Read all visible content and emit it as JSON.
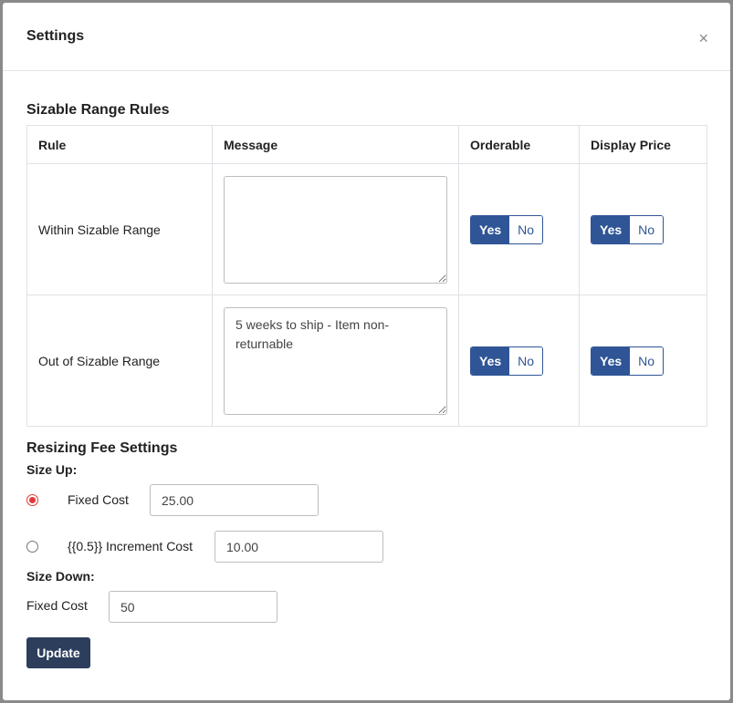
{
  "modal": {
    "title": "Settings",
    "close_label": "×"
  },
  "sizable_range": {
    "title": "Sizable Range Rules",
    "columns": [
      "Rule",
      "Message",
      "Orderable",
      "Display Price"
    ],
    "rows": [
      {
        "rule": "Within Sizable Range",
        "message": "",
        "orderable": {
          "yes": "Yes",
          "no": "No",
          "selected": "Yes"
        },
        "display_price": {
          "yes": "Yes",
          "no": "No",
          "selected": "Yes"
        }
      },
      {
        "rule": "Out of Sizable Range",
        "message": "5 weeks to ship - Item non-returnable",
        "orderable": {
          "yes": "Yes",
          "no": "No",
          "selected": "Yes"
        },
        "display_price": {
          "yes": "Yes",
          "no": "No",
          "selected": "Yes"
        }
      }
    ]
  },
  "resizing_fee": {
    "title": "Resizing Fee Settings",
    "size_up": {
      "label": "Size Up:",
      "fixed_cost": {
        "label": "Fixed Cost",
        "value": "25.00",
        "selected": true
      },
      "increment_cost": {
        "label": "{{0.5}} Increment Cost",
        "value": "10.00",
        "selected": false
      }
    },
    "size_down": {
      "label": "Size Down:",
      "fixed_cost": {
        "label": "Fixed Cost",
        "value": "50"
      }
    }
  },
  "update_label": "Update",
  "colors": {
    "primary": "#2f5596",
    "button_dark": "#2c3e5c",
    "radio_checked": "#e03a3a"
  }
}
